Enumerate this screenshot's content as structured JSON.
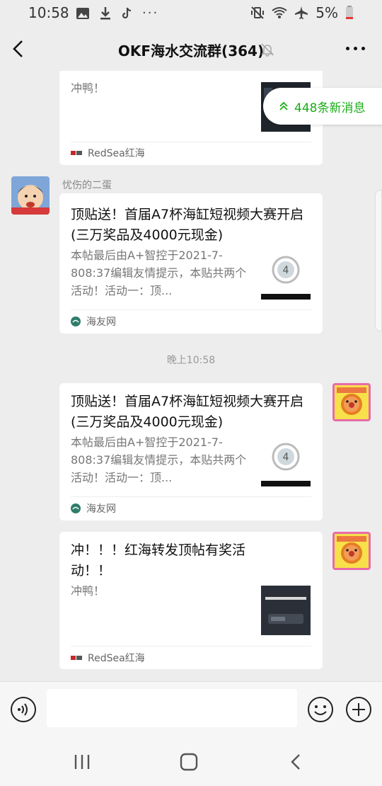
{
  "status": {
    "time": "10:58",
    "battery": "5%"
  },
  "header": {
    "title": "OKF海水交流群(364)"
  },
  "new_messages": {
    "label": "448条新消息"
  },
  "messages": [
    {
      "title": "",
      "desc": "冲鸭！",
      "source": "RedSea红海"
    },
    {
      "sender": "忧伤的二蛋",
      "title": "顶贴送！首届A7杯海缸短视频大赛开启(三万奖品及4000元现金)",
      "desc": "本帖最后由A+智控于2021-7-808:37编辑友情提示，本贴共两个活动！活动一：顶...",
      "source": "海友网"
    },
    {
      "title": "顶贴送！首届A7杯海缸短视频大赛开启(三万奖品及4000元现金)",
      "desc": "本帖最后由A+智控于2021-7-808:37编辑友情提示，本贴共两个活动！活动一：顶...",
      "source": "海友网"
    },
    {
      "title": "冲！！！红海转发顶帖有奖活动！！",
      "desc": "冲鸭！",
      "source": "RedSea红海"
    }
  ],
  "timestamp": "晚上10:58",
  "colors": {
    "accent": "#1aad19",
    "bg": "#ededed"
  }
}
